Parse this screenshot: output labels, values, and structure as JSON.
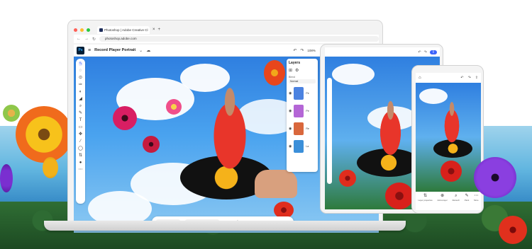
{
  "browser": {
    "tab_title": "Photoshop | Adobe Creative Cl",
    "tab_close": "×",
    "tab_add": "+",
    "nav_back": "←",
    "nav_forward": "→",
    "nav_reload": "↻",
    "url": "photoshop.adobe.com"
  },
  "app_header": {
    "logo": "Ps",
    "menu_icon": "≡",
    "document_title": "Record Player Portrait",
    "title_chevron": "⌄",
    "cloud_icon": "☁",
    "undo_icon": "↶",
    "redo_icon": "↷",
    "zoom": "108%",
    "zoom_chevron": "⌄",
    "desktop_button": "Get desktop app",
    "share_button": "Share"
  },
  "toolbar_icons": [
    "⬁",
    "◌",
    "⊙",
    "✑",
    "◐",
    "◢",
    "⌕",
    "✎",
    "T",
    "▭",
    "✥",
    "⁄",
    "◯",
    "⇅",
    "●",
    "⋯"
  ],
  "layers_panel": {
    "title": "Layers",
    "blend_label": "Blend",
    "blend_value": "Normal",
    "layers": [
      {
        "name": "Pe",
        "thumb_color": "#4b82e0"
      },
      {
        "name": "Pe",
        "thumb_color": "#b466d6"
      },
      {
        "name": "Re",
        "thumb_color": "#d9673c"
      },
      {
        "name": "La",
        "thumb_color": "#3b8fd9"
      }
    ]
  },
  "taskbar": {
    "select_subject": "Select subject",
    "remove_background": "Remove background",
    "layer_name": "Layer 1",
    "chevron": "⌄"
  },
  "phone_toolbar": [
    {
      "icon": "⇅",
      "label": "Layer properties"
    },
    {
      "icon": "⊕",
      "label": "Add a layer"
    },
    {
      "icon": "⌕",
      "label": "Retouch"
    },
    {
      "icon": "✎",
      "label": "Paint"
    },
    {
      "icon": "⋯",
      "label": "More"
    }
  ],
  "colors": {
    "accent": "#3b63fb",
    "ps_blue": "#31a8ff",
    "ps_dark": "#001e36"
  }
}
